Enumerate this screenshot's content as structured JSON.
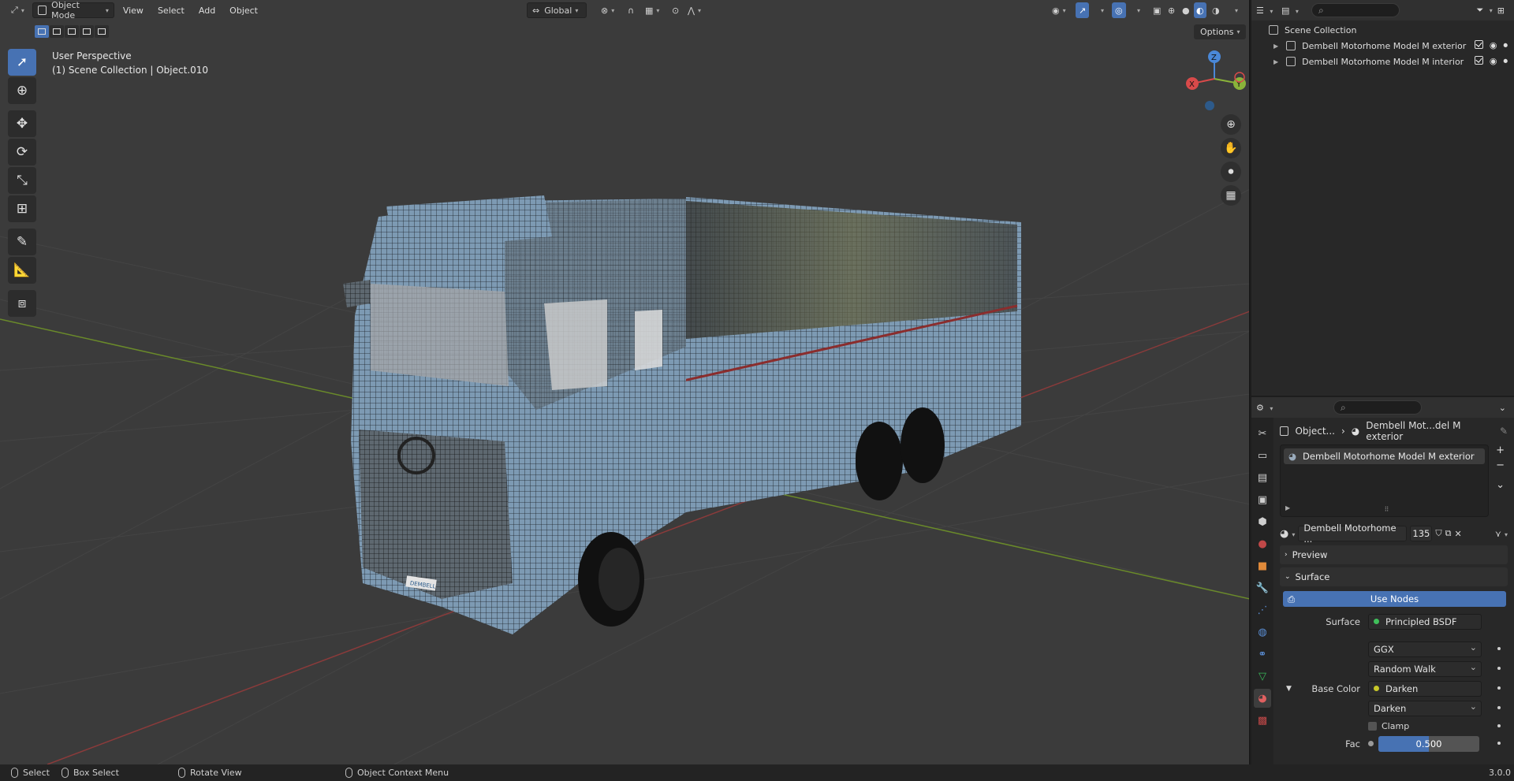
{
  "header": {
    "mode": "Object Mode",
    "menus": [
      "View",
      "Select",
      "Add",
      "Object"
    ],
    "orientation": "Global"
  },
  "viewport": {
    "perspective_label": "User Perspective",
    "collection_label": "(1) Scene Collection | Object.010",
    "options_label": "Options",
    "gizmo": {
      "x": "X",
      "y": "Y",
      "z": "Z"
    },
    "plate_text": "DEMBELL",
    "colors": {
      "background": "#3b3b3b",
      "x_axis": "#8a3b3b",
      "y_axis": "#6a8a2a",
      "mesh": "#7895ad"
    }
  },
  "outliner": {
    "search_placeholder": "",
    "root": "Scene Collection",
    "items": [
      {
        "label": "Dembell Motorhome Model M exterior"
      },
      {
        "label": "Dembell Motorhome Model M  interior"
      }
    ]
  },
  "properties": {
    "breadcrumb_object": "Object...",
    "breadcrumb_material": "Dembell Mot...del M exterior",
    "material_slot": "Dembell Motorhome Model M exterior",
    "material_name": "Dembell Motorhome ...",
    "user_count": "135",
    "sections": {
      "preview": "Preview",
      "surface": "Surface"
    },
    "use_nodes": "Use Nodes",
    "surface_label": "Surface",
    "surface_value": "Principled BSDF",
    "distribution": "GGX",
    "subsurface_method": "Random Walk",
    "base_color_label": "Base Color",
    "base_color_value": "Darken",
    "blend_mode": "Darken",
    "clamp_label": "Clamp",
    "fac_label": "Fac",
    "fac_value": "0.500",
    "fac_fraction": 0.5
  },
  "statusbar": {
    "select": "Select",
    "box_select": "Box Select",
    "rotate_view": "Rotate View",
    "context_menu": "Object Context Menu",
    "version": "3.0.0"
  }
}
